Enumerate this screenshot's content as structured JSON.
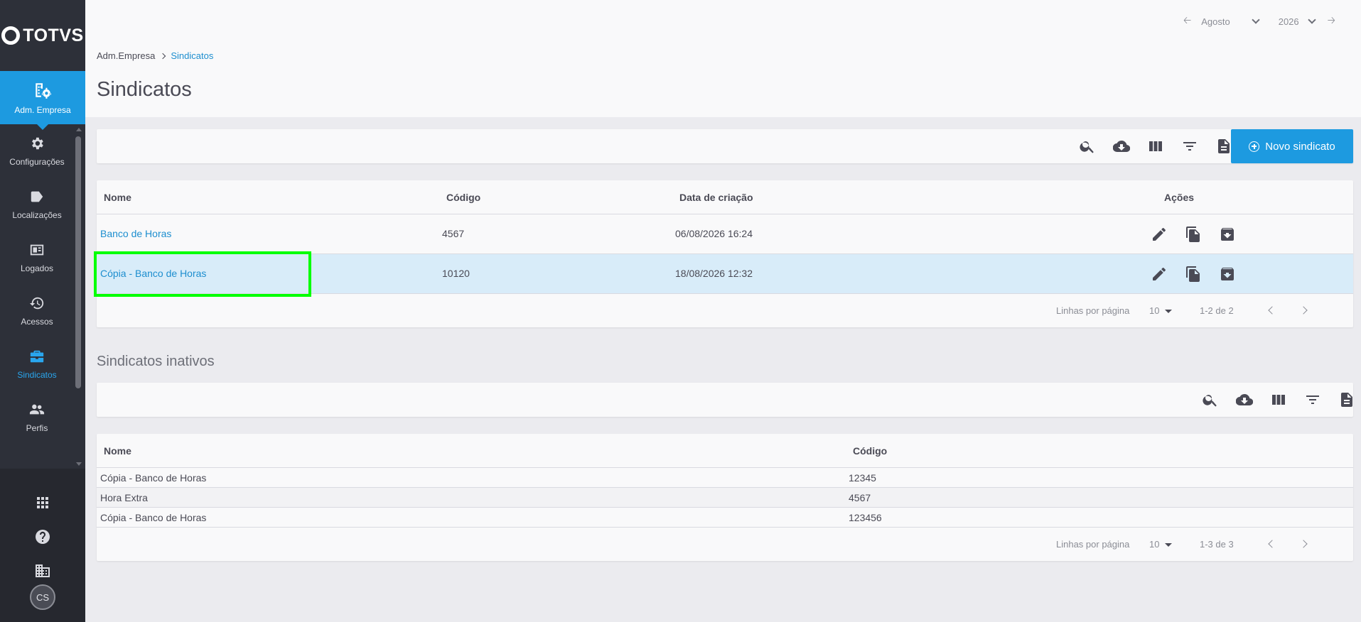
{
  "sidebar": {
    "logo": "TOTVS",
    "active_item": {
      "label": "Adm. Empresa",
      "icon": "building-gear-icon"
    },
    "items": [
      {
        "label": "Configurações",
        "icon": "gear-icon"
      },
      {
        "label": "Localizações",
        "icon": "tag-icon"
      },
      {
        "label": "Logados",
        "icon": "id-card-icon"
      },
      {
        "label": "Acessos",
        "icon": "history-icon"
      },
      {
        "label": "Sindicatos",
        "icon": "briefcase-icon",
        "active": true
      },
      {
        "label": "Perfis",
        "icon": "people-icon"
      }
    ],
    "bottom": {
      "avatar": "CS"
    }
  },
  "header": {
    "period": {
      "month": "Agosto",
      "year": "2026"
    },
    "breadcrumb": {
      "root": "Adm.Empresa",
      "current": "Sindicatos"
    },
    "title": "Sindicatos"
  },
  "active_table": {
    "new_button": "Novo sindicato",
    "columns": {
      "name": "Nome",
      "code": "Código",
      "created": "Data de criação",
      "actions": "Ações"
    },
    "rows": [
      {
        "name": "Banco de Horas",
        "code": "4567",
        "created": "06/08/2026 16:24"
      },
      {
        "name": "Cópia - Banco de Horas",
        "code": "10120",
        "created": "18/08/2026 12:32"
      }
    ],
    "pager": {
      "label": "Linhas por página",
      "per_page": "10",
      "range": "1-2 de 2"
    }
  },
  "inactive_table": {
    "title": "Sindicatos inativos",
    "columns": {
      "name": "Nome",
      "code": "Código"
    },
    "rows": [
      {
        "name": "Cópia - Banco de Horas",
        "code": "12345"
      },
      {
        "name": "Hora Extra",
        "code": "4567"
      },
      {
        "name": "Cópia - Banco de Horas",
        "code": "123456"
      }
    ],
    "pager": {
      "label": "Linhas por página",
      "per_page": "10",
      "range": "1-3 de 3"
    }
  },
  "colors": {
    "primary": "#1d9ae0",
    "sidebar": "#2d3039",
    "highlight": "#00ff00"
  }
}
